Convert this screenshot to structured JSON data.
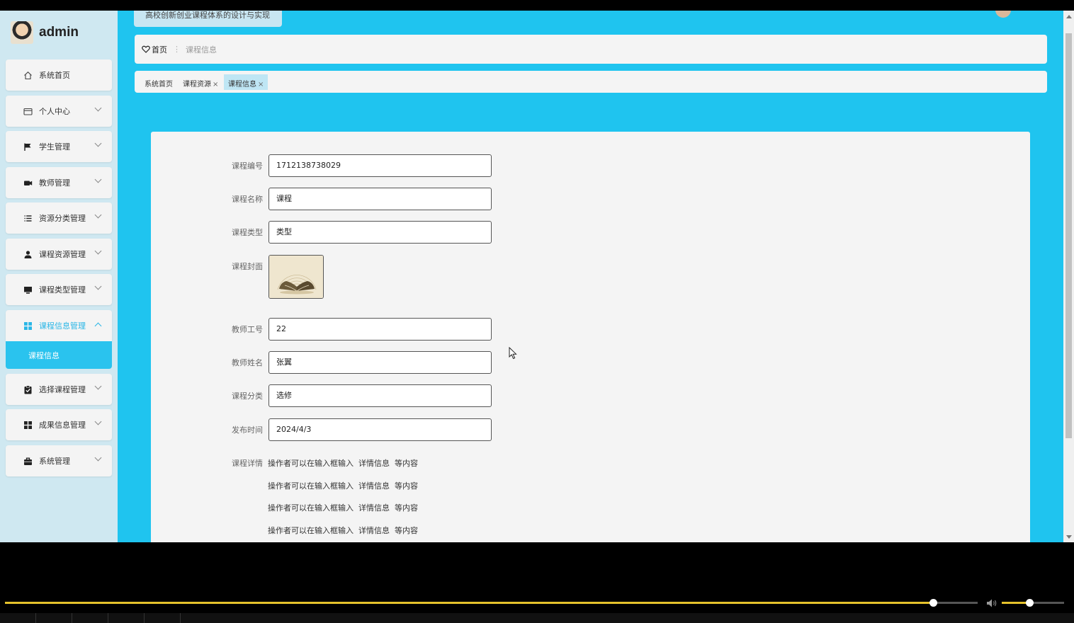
{
  "app": {
    "header_title": "高校创新创业课程体系的设计与实现",
    "username": "admin"
  },
  "sidebar": {
    "items": [
      {
        "label": "系统首页",
        "icon": "home-icon"
      },
      {
        "label": "个人中心",
        "icon": "card-icon"
      },
      {
        "label": "学生管理",
        "icon": "flag-icon"
      },
      {
        "label": "教师管理",
        "icon": "camera-icon"
      },
      {
        "label": "资源分类管理",
        "icon": "list-icon"
      },
      {
        "label": "课程资源管理",
        "icon": "user-icon"
      },
      {
        "label": "课程类型管理",
        "icon": "monitor-icon"
      },
      {
        "label": "课程信息管理",
        "icon": "grid-icon"
      },
      {
        "label": "选择课程管理",
        "icon": "clipboard-icon"
      },
      {
        "label": "成果信息管理",
        "icon": "grid-icon"
      },
      {
        "label": "系统管理",
        "icon": "briefcase-icon"
      }
    ],
    "submenu_label": "课程信息",
    "accent": "#29b6e6"
  },
  "breadcrumb": {
    "home": "首页",
    "current": "课程信息"
  },
  "tabs": [
    {
      "label": "系统首页"
    },
    {
      "label": "课程资源",
      "close": "×"
    },
    {
      "label": "课程信息",
      "close": "×"
    }
  ],
  "form": {
    "course_no": {
      "label": "课程编号",
      "value": "1712138738029"
    },
    "course_name": {
      "label": "课程名称",
      "value": "课程"
    },
    "course_type": {
      "label": "课程类型",
      "value": "类型"
    },
    "cover": {
      "label": "课程封面"
    },
    "teacher_no": {
      "label": "教师工号",
      "value": "22"
    },
    "teacher_name": {
      "label": "教师姓名",
      "value": "张翼"
    },
    "category": {
      "label": "课程分类",
      "value": "选修"
    },
    "publish_time": {
      "label": "发布时间",
      "value": "2024/4/3"
    },
    "detail": {
      "label": "课程详情",
      "lines": [
        "操作者可以在输入框输入  详情信息  等内容",
        "操作者可以在输入框输入  详情信息  等内容",
        "操作者可以在输入框输入  详情信息  等内容",
        "操作者可以在输入框输入  详情信息  等内容"
      ]
    }
  },
  "player": {
    "progress": 0.954,
    "volume": 0.44
  }
}
